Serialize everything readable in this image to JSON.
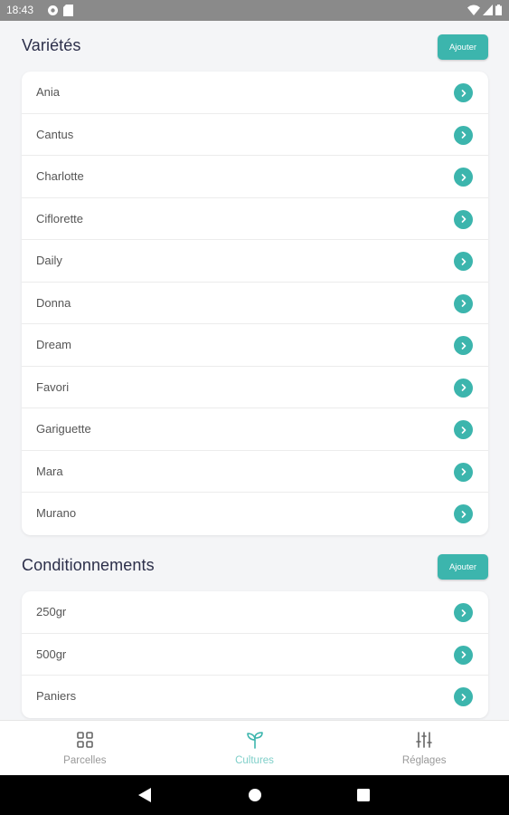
{
  "status_bar": {
    "time": "18:43"
  },
  "varieties": {
    "title": "Variétés",
    "add_label": "Ajouter",
    "items": [
      "Ania",
      "Cantus",
      "Charlotte",
      "Ciflorette",
      "Daily",
      "Donna",
      "Dream",
      "Favori",
      "Gariguette",
      "Mara",
      "Murano"
    ]
  },
  "packaging": {
    "title": "Conditionnements",
    "add_label": "Ajouter",
    "items": [
      "250gr",
      "500gr",
      "Paniers"
    ]
  },
  "bottom_nav": {
    "items": [
      {
        "label": "Parcelles",
        "icon": "grid-icon",
        "active": false
      },
      {
        "label": "Cultures",
        "icon": "sprout-icon",
        "active": true
      },
      {
        "label": "Réglages",
        "icon": "sliders-icon",
        "active": false
      }
    ]
  },
  "colors": {
    "accent": "#3cb5ad",
    "accent_light": "#7fcfc9",
    "title": "#2c2f4a"
  }
}
